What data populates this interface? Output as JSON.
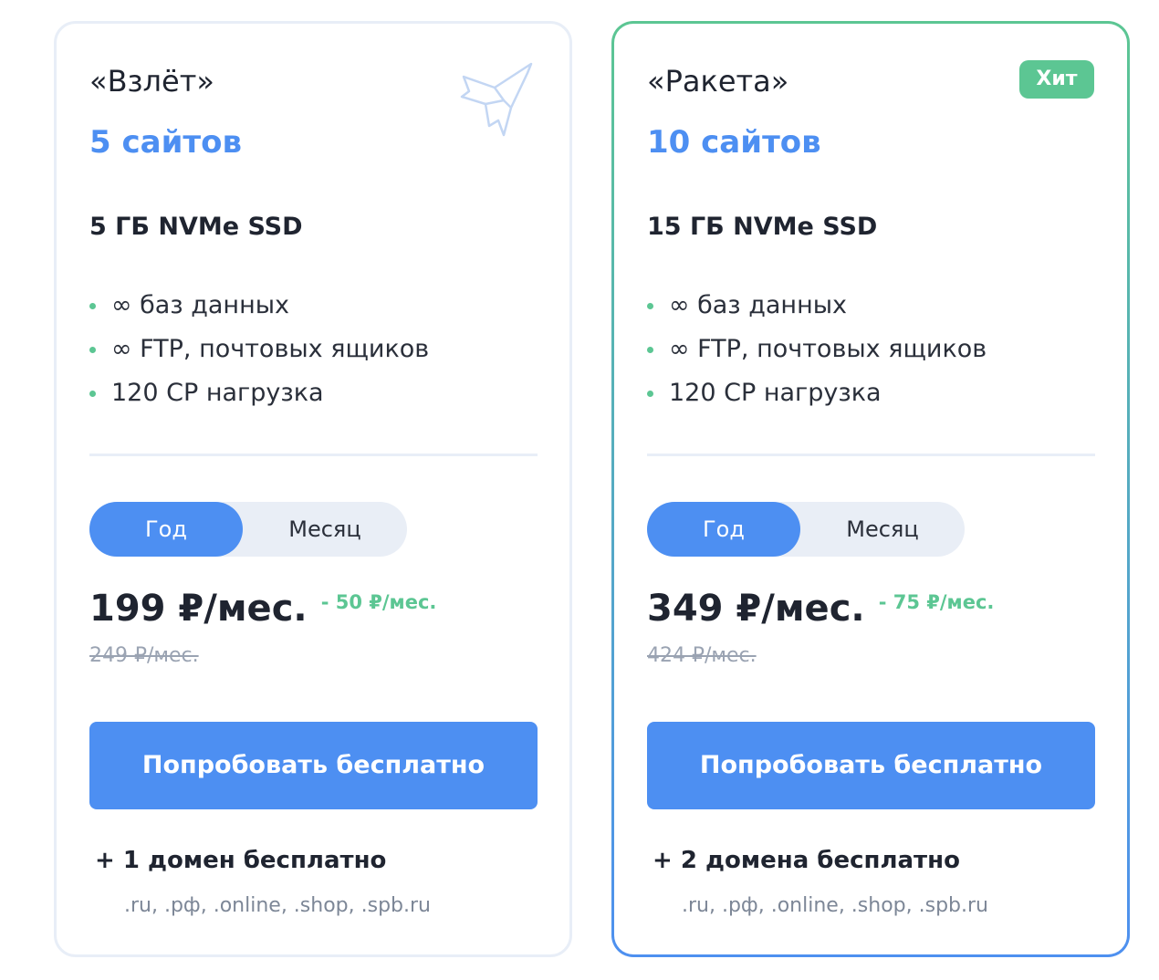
{
  "colors": {
    "accent": "#4d8ff2",
    "green": "#5cc693",
    "text": "#1f2430",
    "muted": "#9aa3b2"
  },
  "plans": [
    {
      "name": "«Взлёт»",
      "sites": "5 сайтов",
      "storage": "5 ГБ NVMe SSD",
      "features": [
        "∞ баз данных",
        "∞ FTP, почтовых ящиков",
        "120 CP нагрузка"
      ],
      "icon": "plane-icon",
      "toggle": {
        "year": "Год",
        "month": "Месяц",
        "selected": "Год"
      },
      "price": "199 ₽/мес.",
      "discount": "- 50 ₽/мес.",
      "old_price": "249 ₽/мес.",
      "cta": "Попробовать бесплатно",
      "domain": "+ 1 домен бесплатно",
      "zones": ".ru, .рф, .online, .shop, .spb.ru"
    },
    {
      "name": "«Ракета»",
      "sites": "10 сайтов",
      "storage": "15 ГБ NVMe SSD",
      "features": [
        "∞ баз данных",
        "∞ FTP, почтовых ящиков",
        "120 CP нагрузка"
      ],
      "badge": "Хит",
      "toggle": {
        "year": "Год",
        "month": "Месяц",
        "selected": "Год"
      },
      "price": "349 ₽/мес.",
      "discount": "- 75 ₽/мес.",
      "old_price": "424 ₽/мес.",
      "cta": "Попробовать бесплатно",
      "domain": "+ 2 домена бесплатно",
      "zones": ".ru, .рф, .online, .shop, .spb.ru"
    }
  ]
}
